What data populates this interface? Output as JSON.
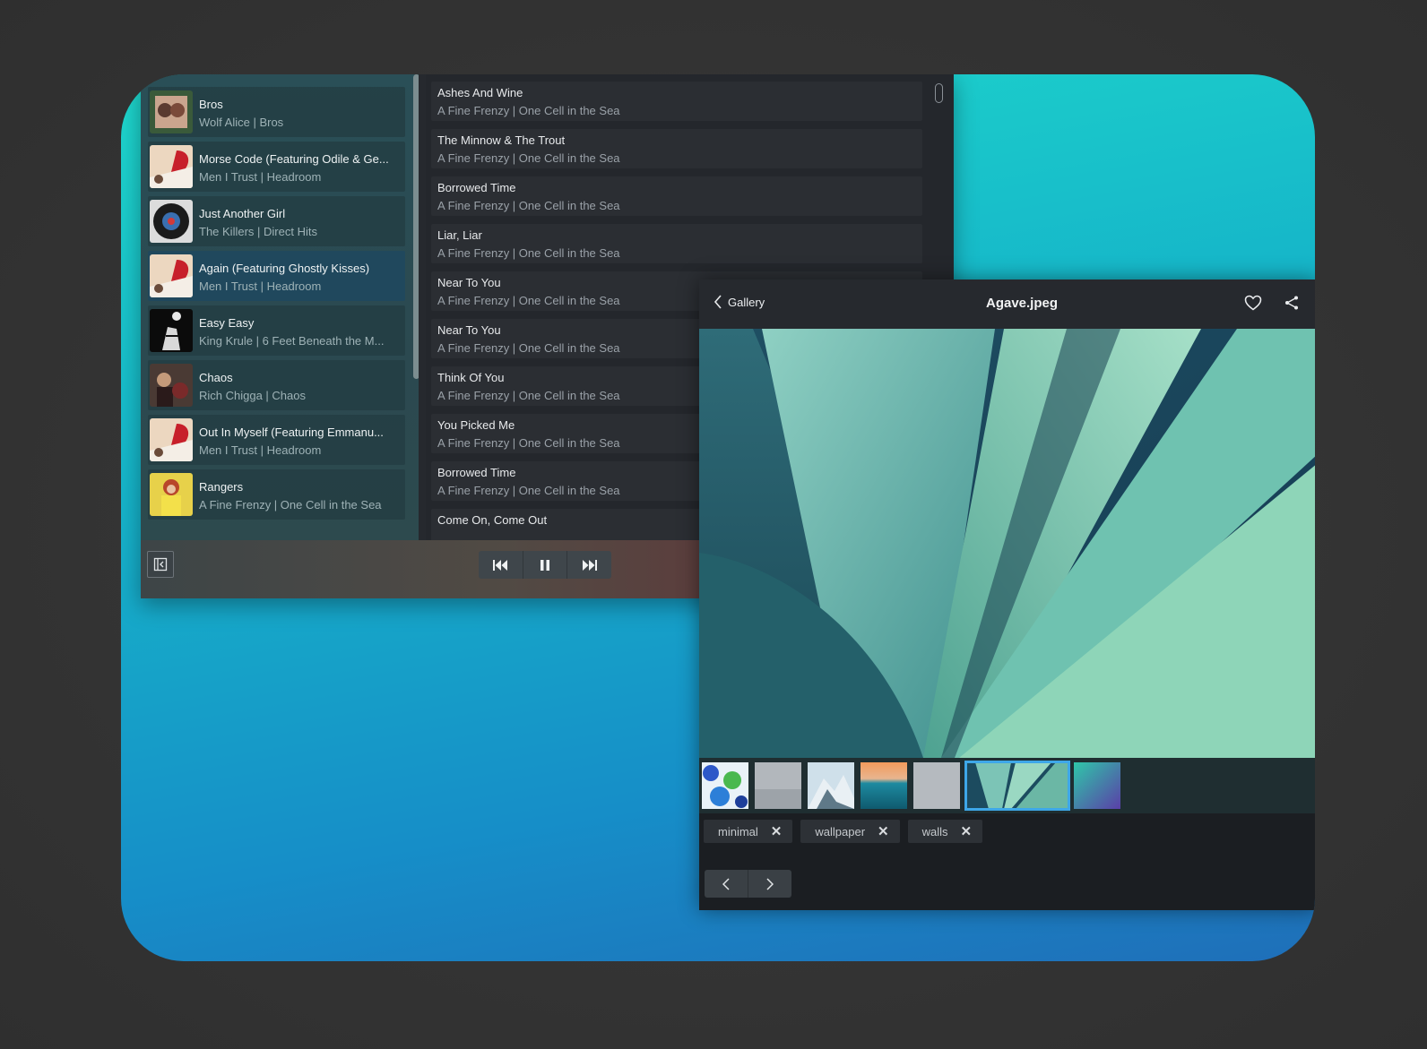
{
  "music": {
    "queue": [
      {
        "title": "Bros",
        "subtitle": "Wolf Alice | Bros",
        "active": false
      },
      {
        "title": "Morse Code (Featuring Odile & Ge...",
        "subtitle": "Men I Trust | Headroom",
        "active": false
      },
      {
        "title": "Just Another Girl",
        "subtitle": "The Killers | Direct Hits",
        "active": false
      },
      {
        "title": "Again (Featuring Ghostly Kisses)",
        "subtitle": "Men I Trust | Headroom",
        "active": true
      },
      {
        "title": "Easy Easy",
        "subtitle": "King Krule | 6 Feet Beneath the M...",
        "active": false
      },
      {
        "title": "Chaos",
        "subtitle": "Rich Chigga | Chaos",
        "active": false
      },
      {
        "title": "Out In Myself (Featuring Emmanu...",
        "subtitle": "Men I Trust | Headroom",
        "active": false
      },
      {
        "title": "Rangers",
        "subtitle": "A Fine Frenzy | One Cell in the Sea",
        "active": false
      }
    ],
    "tracks": [
      {
        "title": "Ashes And Wine",
        "subtitle": "A Fine Frenzy | One Cell in the Sea"
      },
      {
        "title": "The Minnow & The Trout",
        "subtitle": "A Fine Frenzy | One Cell in the Sea"
      },
      {
        "title": "Borrowed Time",
        "subtitle": "A Fine Frenzy | One Cell in the Sea"
      },
      {
        "title": "Liar, Liar",
        "subtitle": "A Fine Frenzy | One Cell in the Sea"
      },
      {
        "title": "Near To You",
        "subtitle": "A Fine Frenzy | One Cell in the Sea"
      },
      {
        "title": "Near To You",
        "subtitle": "A Fine Frenzy | One Cell in the Sea"
      },
      {
        "title": "Think Of You",
        "subtitle": "A Fine Frenzy | One Cell in the Sea"
      },
      {
        "title": "You Picked Me",
        "subtitle": "A Fine Frenzy | One Cell in the Sea"
      },
      {
        "title": "Borrowed Time",
        "subtitle": "A Fine Frenzy | One Cell in the Sea"
      },
      {
        "title": "Come On, Come Out",
        "subtitle": ""
      }
    ],
    "controls": {
      "sidebar_toggle": "sidebar-toggle-icon",
      "previous": "skip-back-icon",
      "pause": "pause-icon",
      "next": "skip-forward-icon"
    }
  },
  "gallery": {
    "back_label": "Gallery",
    "title": "Agave.jpeg",
    "tags": [
      "minimal",
      "wallpaper",
      "walls"
    ],
    "tag_remove_glyph": "✕",
    "selected_thumb": 5
  },
  "colors": {
    "accent": "#3ea7e8",
    "desktop_top": "#1ed7cc",
    "desktop_bottom": "#1f6fb9"
  }
}
